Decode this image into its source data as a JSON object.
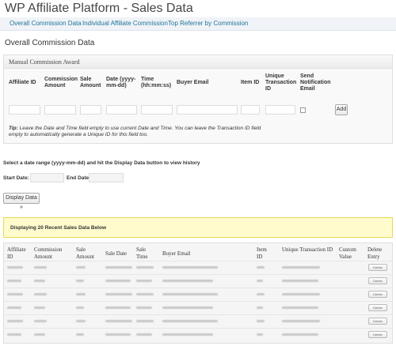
{
  "page": {
    "title": "WP Affiliate Platform - Sales Data"
  },
  "tabs": [
    {
      "label": "Overall Commission Data"
    },
    {
      "label": "Individual Affiliate Commission"
    },
    {
      "label": "Top Referrer by Commission"
    }
  ],
  "section_title": "Overall Commission Data",
  "manual_award": {
    "title": "Manual Commission Award",
    "columns": [
      "Affiliate ID",
      "Commission Amount",
      "Sale Amount",
      "Date (yyyy-mm-dd)",
      "Time (hh:mm:ss)",
      "Buyer Email",
      "Item ID",
      "Unique Transaction ID",
      "Send Notification Email"
    ],
    "add_button": "Add",
    "tip_label": "Tip:",
    "tip_text": "Leave the Date and Time field empty to use current Date and Time. You can leave the Transaction ID field empty to automatically generate a Unique ID for this field too."
  },
  "date_range": {
    "instruction": "Select a date range (yyyy-mm-dd) and hit the Display Data button to view history",
    "start_label": "Start Date:",
    "end_label": "End Date:",
    "start_value": "",
    "end_value": "",
    "display_button": "Display Data »"
  },
  "notice": "Displaying 20 Recent Sales Data Below",
  "sales_table": {
    "headers": [
      "Affiliate ID",
      "Commission Amount",
      "Sale Amount",
      "Sale Date",
      "Sale Time",
      "Buyer Email",
      "Item ID",
      "Unique Transaction ID",
      "Custom Value",
      "Delete Entry"
    ],
    "delete_label": "Delete",
    "row_count": 6
  }
}
